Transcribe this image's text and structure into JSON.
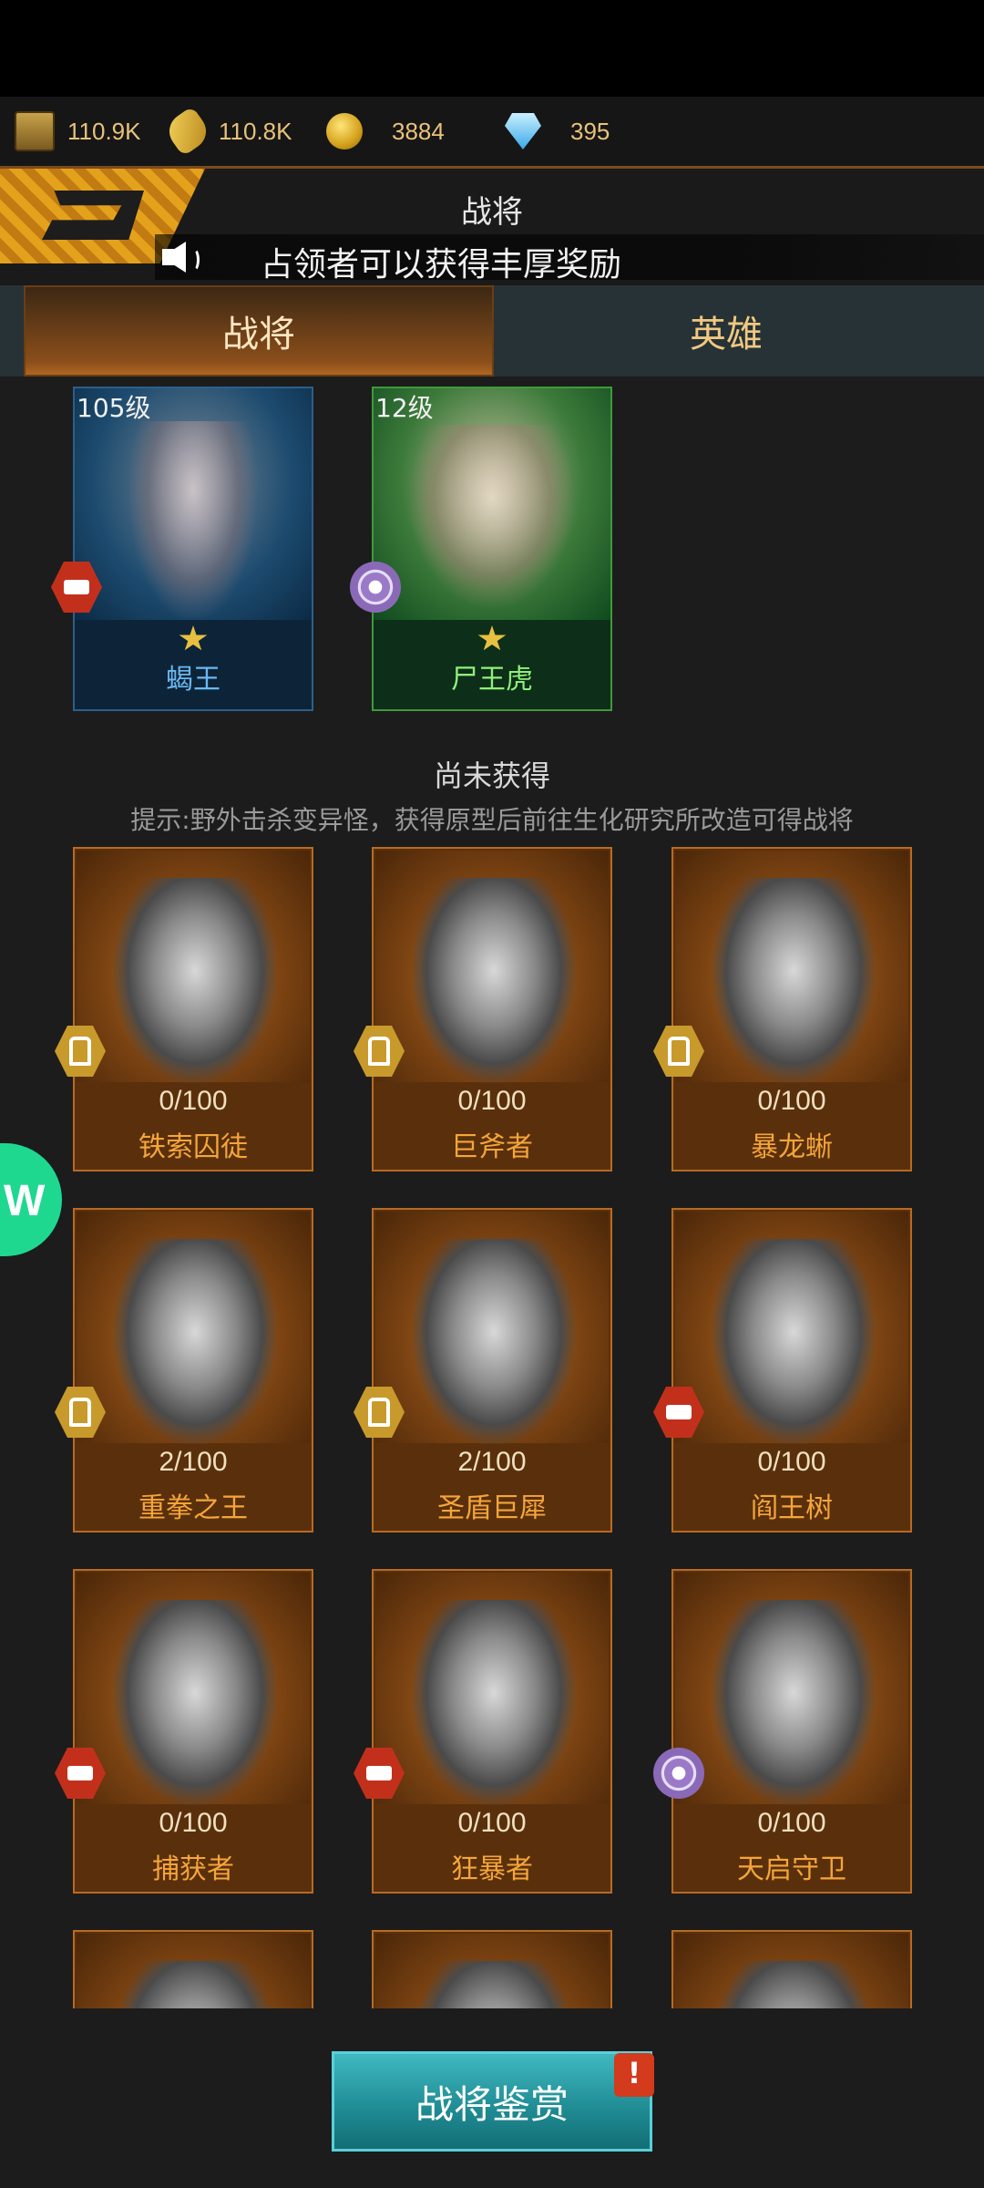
{
  "resources": [
    {
      "icon": "crate-icon",
      "value": "110.9K"
    },
    {
      "icon": "ammo-icon",
      "value": "110.8K"
    },
    {
      "icon": "coin-icon",
      "value": "3884"
    },
    {
      "icon": "diamond-icon",
      "value": "395"
    }
  ],
  "header": {
    "title": "战将",
    "announcement": "占领者可以获得丰厚奖励"
  },
  "tabs": [
    {
      "label": "战将",
      "active": true
    },
    {
      "label": "英雄",
      "active": false
    }
  ],
  "owned": [
    {
      "level": "105级",
      "name": "蝎王",
      "rarity_color": "#2c5f8a",
      "badge": "red-badge-icon"
    },
    {
      "level": "12级",
      "name": "尸王虎",
      "rarity_color": "#3f9a3a",
      "badge": "purple-badge-icon"
    }
  ],
  "not_owned": {
    "title": "尚未获得",
    "hint": "提示:野外击杀变异怪，获得原型后前往生化研究所改造可得战将",
    "cards": [
      {
        "progress": "0/100",
        "name": "铁索囚徒",
        "badge": "gold"
      },
      {
        "progress": "0/100",
        "name": "巨斧者",
        "badge": "gold"
      },
      {
        "progress": "0/100",
        "name": "暴龙蜥",
        "badge": "gold"
      },
      {
        "progress": "2/100",
        "name": "重拳之王",
        "badge": "gold"
      },
      {
        "progress": "2/100",
        "name": "圣盾巨犀",
        "badge": "gold"
      },
      {
        "progress": "0/100",
        "name": "阎王树",
        "badge": "red"
      },
      {
        "progress": "0/100",
        "name": "捕获者",
        "badge": "red"
      },
      {
        "progress": "0/100",
        "name": "狂暴者",
        "badge": "red"
      },
      {
        "progress": "0/100",
        "name": "天启守卫",
        "badge": "purple"
      }
    ]
  },
  "bottom_button": {
    "label": "战将鉴赏",
    "alert": "!"
  }
}
